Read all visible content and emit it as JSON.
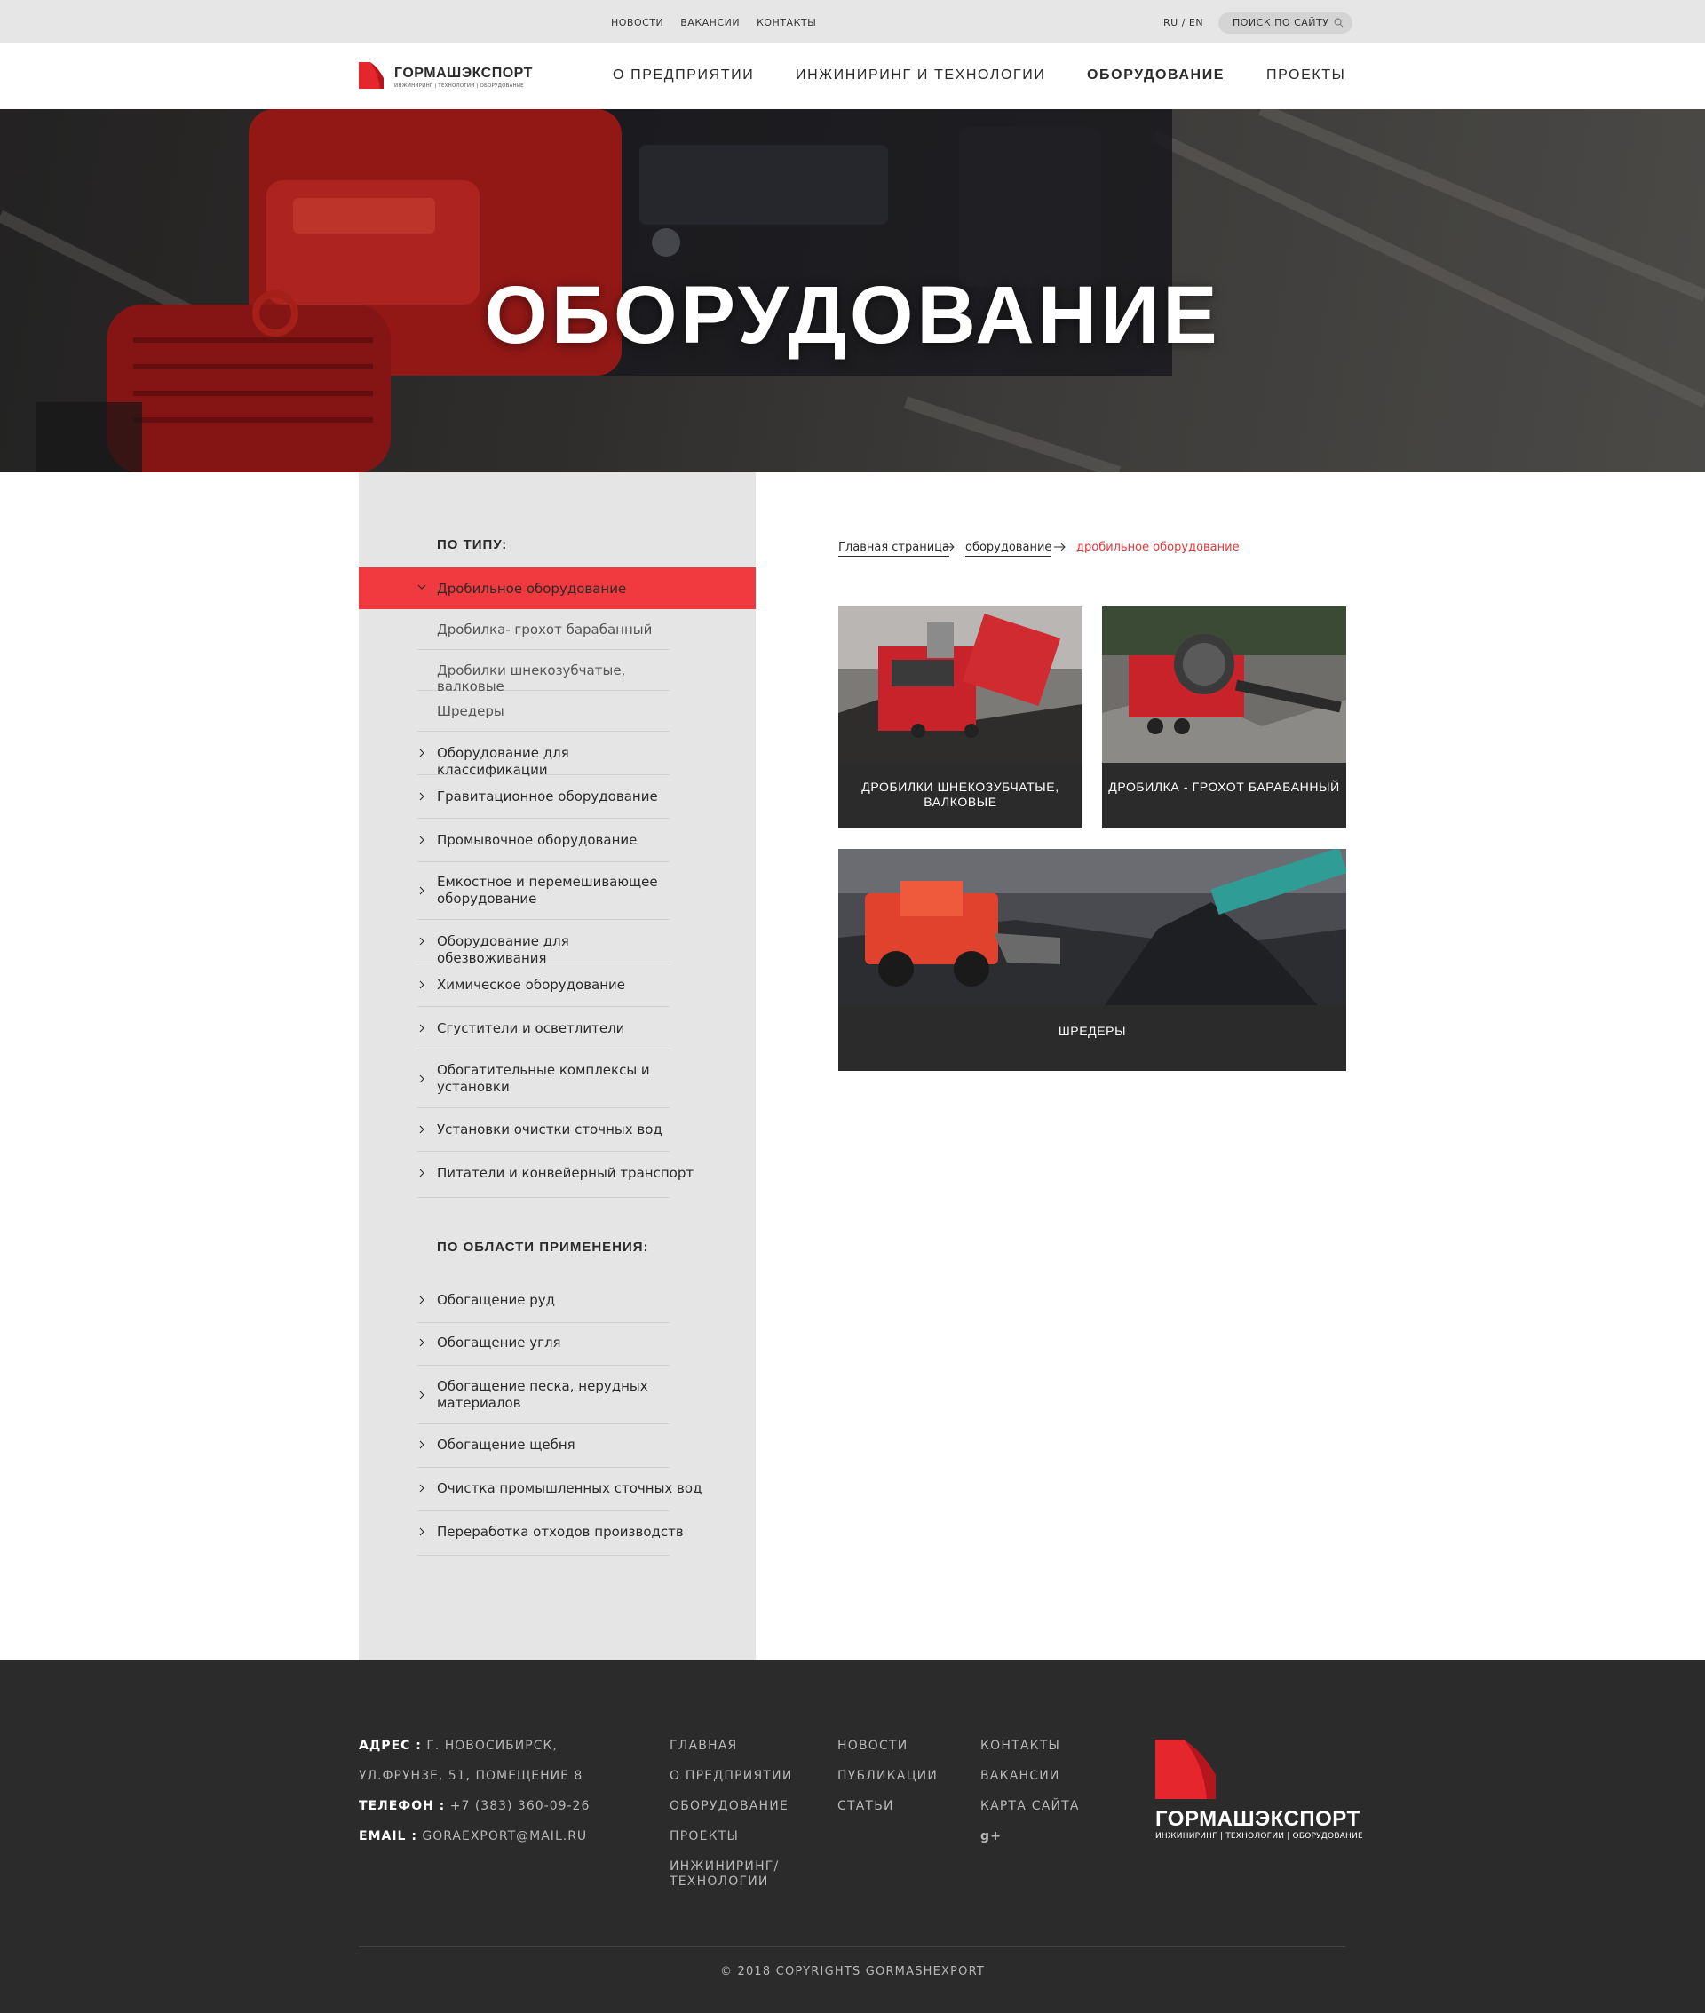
{
  "topbar": {
    "links": [
      "НОВОСТИ",
      "ВАКАНСИИ",
      "КОНТАКТЫ"
    ],
    "lang": "RU / EN",
    "search_placeholder": "ПОИСК ПО САЙТУ"
  },
  "header": {
    "logo_name": "ГОРМАШЭКСПОРТ",
    "logo_tagline": "ИНЖИНИРИНГ | ТЕХНОЛОГИИ | ОБОРУДОВАНИЕ",
    "nav": [
      "О ПРЕДПРИЯТИИ",
      "ИНЖИНИРИНГ И ТЕХНОЛОГИИ",
      "ОБОРУДОВАНИЕ",
      "ПРОЕКТЫ"
    ],
    "active_nav": "ОБОРУДОВАНИЕ"
  },
  "hero": {
    "title": "ОБОРУДОВАНИЕ"
  },
  "sidebar": {
    "type_heading": "ПО ТИПУ:",
    "active_item": "Дробильное оборудование",
    "sub_items": [
      "Дробилка- грохот барабанный",
      "Дробилки шнекозубчатые, валковые",
      "Шредеры"
    ],
    "type_items": [
      "Оборудование для классификации",
      "Гравитационное оборудование",
      "Промывочное оборудование",
      "Емкостное и перемешивающее оборудование",
      "Оборудование для обезвоживания",
      "Химическое оборудование",
      "Сгустители и осветлители",
      "Обогатительные комплексы и установки",
      "Установки очистки сточных вод",
      "Питатели и конвейерный транспорт"
    ],
    "area_heading": "ПО ОБЛАСТИ ПРИМЕНЕНИЯ:",
    "area_items": [
      "Обогащение руд",
      "Обогащение угля",
      "Обогащение песка, нерудных материалов",
      "Обогащение щебня",
      "Очистка промышленных сточных вод",
      "Переработка отходов производств"
    ]
  },
  "breadcrumb": {
    "items": [
      "Главная страница",
      "оборудование"
    ],
    "current": "дробильное оборудование"
  },
  "cards": [
    {
      "caption": "ДРОБИЛКИ ШНЕКОЗУБЧАТЫЕ, ВАЛКОВЫЕ"
    },
    {
      "caption": "ДРОБИЛКА - ГРОХОТ БАРАБАННЫЙ"
    },
    {
      "caption": "ШРЕДЕРЫ"
    }
  ],
  "footer": {
    "address_label": "АДРЕС :",
    "address_line1": " Г. НОВОСИБИРСК,",
    "address_line2": "УЛ.ФРУНЗЕ, 51, ПОМЕЩЕНИЕ 8",
    "phone_label": "ТЕЛЕФОН :",
    "phone": " +7 (383) 360-09-26",
    "email_label": "EMAIL :",
    "email": " GORAEXPORT@MAIL.RU",
    "col1": [
      "ГЛАВНАЯ",
      "О ПРЕДПРИЯТИИ",
      "ОБОРУДОВАНИЕ",
      "ПРОЕКТЫ",
      "ИНЖИНИРИНГ/",
      "ТЕХНОЛОГИИ"
    ],
    "col2": [
      "НОВОСТИ",
      "ПУБЛИКАЦИИ",
      "СТАТЬИ"
    ],
    "col3": [
      "КОНТАКТЫ",
      "ВАКАНСИИ",
      "КАРТА САЙТА"
    ],
    "social": "g+",
    "logo_name": "ГОРМАШЭКСПОРТ",
    "logo_tagline": "ИНЖИНИРИНГ | ТЕХНОЛОГИИ | ОБОРУДОВАНИЕ",
    "copyright": "© 2018 COPYRIGHTS GORMASHEXPORT"
  },
  "colors": {
    "accent": "#f03a3f",
    "dark": "#2b2b2b",
    "sidebar": "#e5e5e5"
  }
}
